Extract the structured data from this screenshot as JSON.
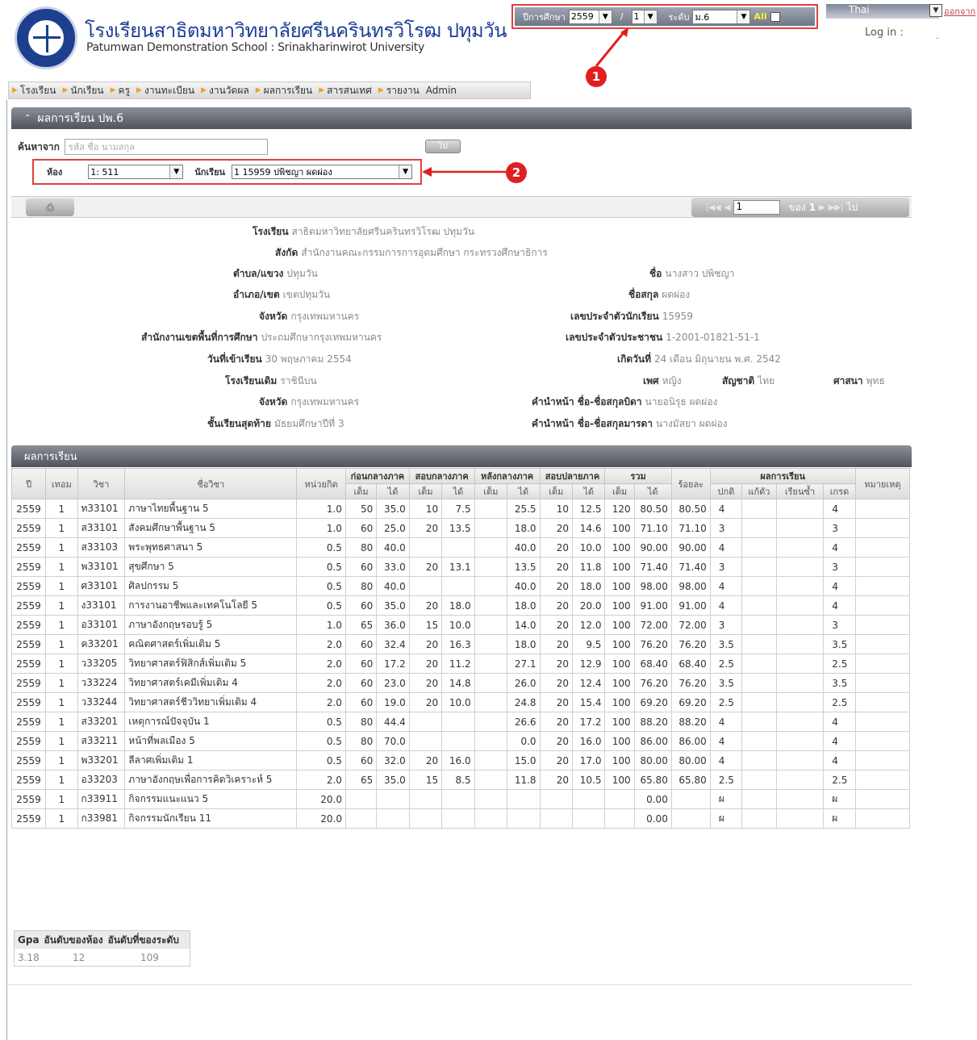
{
  "header": {
    "school_name_th": "โรงเรียนสาธิตมหาวิทยาลัยศรีนครินทรวิโรฒ ปทุมวัน",
    "school_name_en": "Patumwan Demonstration School : Srinakharinwirot University",
    "year_label": "ปีการศึกษา",
    "year_value": "2559",
    "slash": "/",
    "term_value": "1",
    "level_label": "ระดับ",
    "level_value": "ม.6",
    "all_label": "All",
    "language": "Thai",
    "logout": "ออกจาก",
    "login_label": "Log in :",
    "login_value": "-",
    "marker1": "1",
    "marker2": "2"
  },
  "nav": [
    {
      "label": "โรงเรียน"
    },
    {
      "label": "นักเรียน"
    },
    {
      "label": "ครู"
    },
    {
      "label": "งานทะเบียน"
    },
    {
      "label": "งานวัดผล"
    },
    {
      "label": "ผลการเรียน"
    },
    {
      "label": "สารสนเทศ"
    },
    {
      "label": "รายงาน"
    },
    {
      "label": "Admin"
    }
  ],
  "panel": {
    "title": "ผลการเรียน ปพ.6",
    "search_label": "ค้นหาจาก",
    "search_placeholder": "รหัส ชื่อ นามสกุล",
    "go_label": "ไป",
    "room_label": "ห้อง",
    "room_value": "1: 511",
    "student_label": "นักเรียน",
    "student_value": "1 15959 ปพิชญา ผดผ่อง"
  },
  "pager": {
    "page": "1",
    "of_label": "ของ",
    "total": "1",
    "go_label": "ไป"
  },
  "info": {
    "school_label": "โรงเรียน",
    "school_value": "สาธิตมหาวิทยาลัยศรีนครินทรวิโรฒ ปทุมวัน",
    "affil_label": "สังกัด",
    "affil_value": "สำนักงานคณะกรรมการการอุดมศึกษา กระทรวงศึกษาธิการ",
    "subdist_label": "ตำบล/แขวง",
    "subdist_value": "ปทุมวัน",
    "dist_label": "อำเภอ/เขต",
    "dist_value": "เขตปทุมวัน",
    "prov_label": "จังหวัด",
    "prov_value": "กรุงเทพมหานคร",
    "area_label": "สำนักงานเขตพื้นที่การศึกษา",
    "area_value": "ประถมศึกษากรุงเทพมหานคร",
    "enroll_label": "วันที่เข้าเรียน",
    "enroll_value": "30 พฤษภาคม 2554",
    "prev_school_label": "โรงเรียนเดิม",
    "prev_school_value": "ราชินีบน",
    "prev_prov_label": "จังหวัด",
    "prev_prov_value": "กรุงเทพมหานคร",
    "last_grade_label": "ชั้นเรียนสุดท้าย",
    "last_grade_value": "มัธยมศึกษาปีที่ 3",
    "name_label": "ชื่อ",
    "name_value": "นางสาว ปพิชญา",
    "surname_label": "ชื่อสกุล",
    "surname_value": "ผดผ่อง",
    "student_id_label": "เลขประจำตัวนักเรียน",
    "student_id_value": "15959",
    "citizen_id_label": "เลขประจำตัวประชาชน",
    "citizen_id_value": "1-2001-01821-51-1",
    "birth_label": "เกิดวันที่",
    "birth_value": "24 เดือน มิถุนายน พ.ศ. 2542",
    "sex_label": "เพศ",
    "sex_value": "หญิง",
    "nation_label": "สัญชาติ",
    "nation_value": "ไทย",
    "religion_label": "ศาสนา",
    "religion_value": "พุทธ",
    "father_label": "คำนำหน้า ชื่อ-ชื่อสกุลบิดา",
    "father_value": "นายอนิรุธ ผดผ่อง",
    "mother_label": "คำนำหน้า ชื่อ-ชื่อสกุลมารดา",
    "mother_value": "นางมัสยา ผดผ่อง"
  },
  "grades": {
    "title": "ผลการเรียน",
    "headers": {
      "year": "ปี",
      "term": "เทอม",
      "code": "วิชา",
      "name": "ชื่อวิชา",
      "credit": "หน่วยกิต",
      "pre_mid": "ก่อนกลางภาค",
      "mid": "สอบกลางภาค",
      "post_mid": "หลังกลางภาค",
      "final": "สอบปลายภาค",
      "total": "รวม",
      "percent": "ร้อยละ",
      "result": "ผลการเรียน",
      "note": "หมายเหตุ",
      "full": "เต็ม",
      "got": "ได้",
      "normal": "ปกติ",
      "fix": "แก้ตัว",
      "repeat": "เรียนซ้ำ",
      "grade": "เกรด"
    },
    "rows": [
      [
        "2559",
        "1",
        "ท33101",
        "ภาษาไทยพื้นฐาน 5",
        "1.0",
        "50",
        "35.0",
        "10",
        "7.5",
        "",
        "25.5",
        "10",
        "12.5",
        "120",
        "80.50",
        "80.50",
        "4",
        "",
        "",
        "4",
        ""
      ],
      [
        "2559",
        "1",
        "ส33101",
        "สังคมศึกษาพื้นฐาน 5",
        "1.0",
        "60",
        "25.0",
        "20",
        "13.5",
        "",
        "18.0",
        "20",
        "14.6",
        "100",
        "71.10",
        "71.10",
        "3",
        "",
        "",
        "3",
        ""
      ],
      [
        "2559",
        "1",
        "ส33103",
        "พระพุทธศาสนา 5",
        "0.5",
        "80",
        "40.0",
        "",
        "",
        "",
        "40.0",
        "20",
        "10.0",
        "100",
        "90.00",
        "90.00",
        "4",
        "",
        "",
        "4",
        ""
      ],
      [
        "2559",
        "1",
        "พ33101",
        "สุขศึกษา 5",
        "0.5",
        "60",
        "33.0",
        "20",
        "13.1",
        "",
        "13.5",
        "20",
        "11.8",
        "100",
        "71.40",
        "71.40",
        "3",
        "",
        "",
        "3",
        ""
      ],
      [
        "2559",
        "1",
        "ศ33101",
        "ศิลปกรรม 5",
        "0.5",
        "80",
        "40.0",
        "",
        "",
        "",
        "40.0",
        "20",
        "18.0",
        "100",
        "98.00",
        "98.00",
        "4",
        "",
        "",
        "4",
        ""
      ],
      [
        "2559",
        "1",
        "ง33101",
        "การงานอาชีพและเทคโนโลยี 5",
        "0.5",
        "60",
        "35.0",
        "20",
        "18.0",
        "",
        "18.0",
        "20",
        "20.0",
        "100",
        "91.00",
        "91.00",
        "4",
        "",
        "",
        "4",
        ""
      ],
      [
        "2559",
        "1",
        "อ33101",
        "ภาษาอังกฤษรอบรู้ 5",
        "1.0",
        "65",
        "36.0",
        "15",
        "10.0",
        "",
        "14.0",
        "20",
        "12.0",
        "100",
        "72.00",
        "72.00",
        "3",
        "",
        "",
        "3",
        ""
      ],
      [
        "2559",
        "1",
        "ค33201",
        "คณิตศาสตร์เพิ่มเติม 5",
        "2.0",
        "60",
        "32.4",
        "20",
        "16.3",
        "",
        "18.0",
        "20",
        "9.5",
        "100",
        "76.20",
        "76.20",
        "3.5",
        "",
        "",
        "3.5",
        ""
      ],
      [
        "2559",
        "1",
        "ว33205",
        "วิทยาศาสตร์ฟิสิกส์เพิ่มเติม 5",
        "2.0",
        "60",
        "17.2",
        "20",
        "11.2",
        "",
        "27.1",
        "20",
        "12.9",
        "100",
        "68.40",
        "68.40",
        "2.5",
        "",
        "",
        "2.5",
        ""
      ],
      [
        "2559",
        "1",
        "ว33224",
        "วิทยาศาสตร์เคมีเพิ่มเติม 4",
        "2.0",
        "60",
        "23.0",
        "20",
        "14.8",
        "",
        "26.0",
        "20",
        "12.4",
        "100",
        "76.20",
        "76.20",
        "3.5",
        "",
        "",
        "3.5",
        ""
      ],
      [
        "2559",
        "1",
        "ว33244",
        "วิทยาศาสตร์ชีววิทยาเพิ่มเติม 4",
        "2.0",
        "60",
        "19.0",
        "20",
        "10.0",
        "",
        "24.8",
        "20",
        "15.4",
        "100",
        "69.20",
        "69.20",
        "2.5",
        "",
        "",
        "2.5",
        ""
      ],
      [
        "2559",
        "1",
        "ส33201",
        "เหตุการณ์ปัจจุบัน 1",
        "0.5",
        "80",
        "44.4",
        "",
        "",
        "",
        "26.6",
        "20",
        "17.2",
        "100",
        "88.20",
        "88.20",
        "4",
        "",
        "",
        "4",
        ""
      ],
      [
        "2559",
        "1",
        "ส33211",
        "หน้าที่พลเมือง 5",
        "0.5",
        "80",
        "70.0",
        "",
        "",
        "",
        "0.0",
        "20",
        "16.0",
        "100",
        "86.00",
        "86.00",
        "4",
        "",
        "",
        "4",
        ""
      ],
      [
        "2559",
        "1",
        "พ33201",
        "ลีลาศเพิ่มเติม 1",
        "0.5",
        "60",
        "32.0",
        "20",
        "16.0",
        "",
        "15.0",
        "20",
        "17.0",
        "100",
        "80.00",
        "80.00",
        "4",
        "",
        "",
        "4",
        ""
      ],
      [
        "2559",
        "1",
        "อ33203",
        "ภาษาอังกฤษเพื่อการคิดวิเคราะห์ 5",
        "2.0",
        "65",
        "35.0",
        "15",
        "8.5",
        "",
        "11.8",
        "20",
        "10.5",
        "100",
        "65.80",
        "65.80",
        "2.5",
        "",
        "",
        "2.5",
        ""
      ],
      [
        "2559",
        "1",
        "ก33911",
        "กิจกรรมแนะแนว 5",
        "20.0",
        "",
        "",
        "",
        "",
        "",
        "",
        "",
        "",
        "",
        "0.00",
        "",
        "ผ",
        "",
        "",
        "ผ",
        ""
      ],
      [
        "2559",
        "1",
        "ก33981",
        "กิจกรรมนักเรียน 11",
        "20.0",
        "",
        "",
        "",
        "",
        "",
        "",
        "",
        "",
        "",
        "0.00",
        "",
        "ผ",
        "",
        "",
        "ผ",
        ""
      ]
    ]
  },
  "gpa": {
    "gpa_label": "Gpa",
    "class_rank_label": "อันดับของห้อง",
    "level_rank_label": "อันดับที่ของระดับ",
    "gpa_value": "3.18",
    "class_rank_value": "12",
    "level_rank_value": "109"
  },
  "colors": {
    "accent": "#1c3f94",
    "highlight_box": "#e04040",
    "nav_arrow": "#f0a020"
  }
}
